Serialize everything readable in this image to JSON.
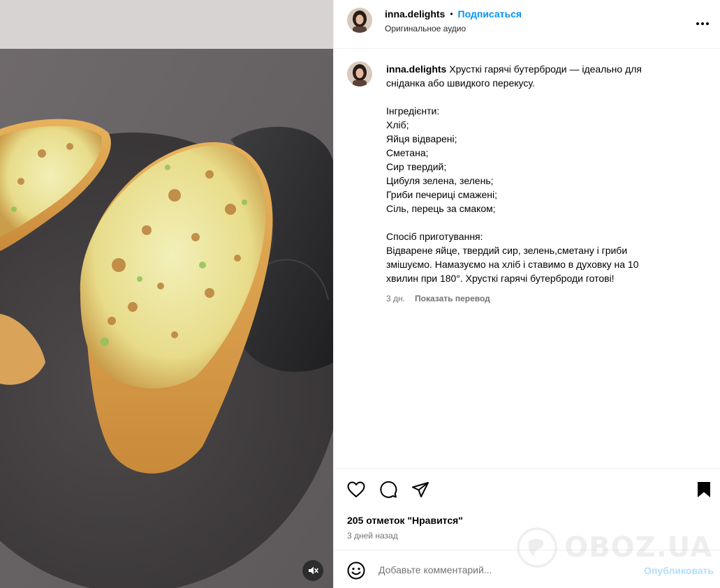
{
  "post": {
    "username": "inna.delights",
    "follow_label": "Подписаться",
    "audio_label": "Оригинальное аудио",
    "more_icon": "more-horizontal-icon"
  },
  "caption": {
    "username": "inna.delights",
    "lines": [
      "Хрусткі гарячі бутерброди — ідеально для",
      "сніданка або швидкого перекусу.",
      "",
      "Інгредієнти:",
      "Хліб;",
      "Яйця відварені;",
      "Сметана;",
      "Сир твердий;",
      "Цибуля зелена, зелень;",
      "Гриби печериці смажені;",
      "Сіль, перець за смаком;",
      "",
      "Спосіб приготування:",
      "Відварене яйце, твердий сир, зелень,сметану і гриби",
      "змішуємо. Намазуємо на хліб і ставимо в духовку на 10",
      "хвилин при 180°. Хрусткі гарячі бутерброди готові!"
    ],
    "time": "3 дн.",
    "translate_label": "Показать перевод"
  },
  "actions": {
    "icons": [
      "heart-icon",
      "comment-icon",
      "share-icon",
      "bookmark-icon"
    ],
    "likes_text": "205 отметок \"Нравится\"",
    "time_ago": "3 дней назад"
  },
  "comment": {
    "placeholder": "Добавьте комментарий...",
    "publish_label": "Опубликовать"
  },
  "watermark": {
    "text": "OBOZ.UA"
  },
  "colors": {
    "accent": "#0095f6",
    "publish_disabled": "#b2dffc",
    "secondary_text": "#737373",
    "divider": "#efefef"
  }
}
